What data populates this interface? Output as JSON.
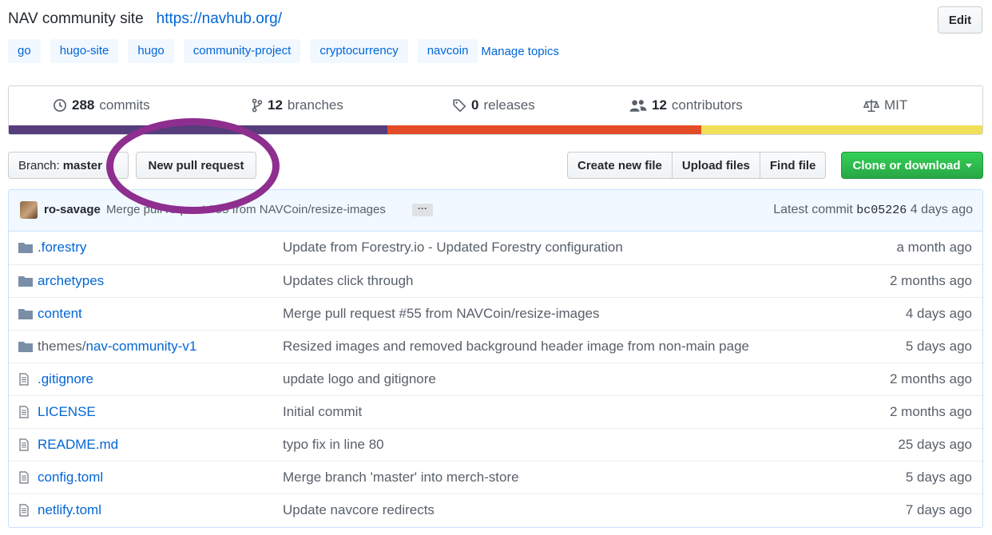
{
  "repo": {
    "description": "NAV community site",
    "url": "https://navhub.org/",
    "edit_label": "Edit",
    "topics": [
      "go",
      "hugo-site",
      "hugo",
      "community-project",
      "cryptocurrency",
      "navcoin"
    ],
    "manage_topics_label": "Manage topics"
  },
  "stats": {
    "commits_count": "288",
    "commits_label": "commits",
    "branches_count": "12",
    "branches_label": "branches",
    "releases_count": "0",
    "releases_label": "releases",
    "contributors_count": "12",
    "contributors_label": "contributors",
    "license": "MIT"
  },
  "language_bar": [
    {
      "color": "#563d7c",
      "fraction": 0.389
    },
    {
      "color": "#e34c26",
      "fraction": 0.322
    },
    {
      "color": "#f1e05a",
      "fraction": 0.289
    }
  ],
  "toolbar": {
    "branch_prefix": "Branch:",
    "branch_name": "master",
    "new_pr_label": "New pull request",
    "create_file_label": "Create new file",
    "upload_label": "Upload files",
    "find_label": "Find file",
    "clone_label": "Clone or download"
  },
  "latest_commit": {
    "author": "ro-savage",
    "message": "Merge pull request #55 from NAVCoin/resize-images",
    "prefix": "Latest commit",
    "sha": "bc05226",
    "age": "4 days ago"
  },
  "files": [
    {
      "type": "folder",
      "name": ".forestry",
      "message": "Update from Forestry.io - Updated Forestry configuration",
      "age": "a month ago"
    },
    {
      "type": "folder",
      "name": "archetypes",
      "message": "Updates click through",
      "age": "2 months ago"
    },
    {
      "type": "folder",
      "name": "content",
      "message": "Merge pull request #55 from NAVCoin/resize-images",
      "age": "4 days ago"
    },
    {
      "type": "folder",
      "name_prefix": "themes/",
      "name": "nav-community-v1",
      "message": "Resized images and removed background header image from non-main page",
      "age": "5 days ago"
    },
    {
      "type": "file",
      "name": ".gitignore",
      "message": "update logo and gitignore",
      "age": "2 months ago"
    },
    {
      "type": "file",
      "name": "LICENSE",
      "message": "Initial commit",
      "age": "2 months ago"
    },
    {
      "type": "file",
      "name": "README.md",
      "message": "typo fix in line 80",
      "age": "25 days ago"
    },
    {
      "type": "file",
      "name": "config.toml",
      "message": "Merge branch 'master' into merch-store",
      "age": "5 days ago"
    },
    {
      "type": "file",
      "name": "netlify.toml",
      "message": "Update navcore redirects",
      "age": "7 days ago"
    }
  ]
}
